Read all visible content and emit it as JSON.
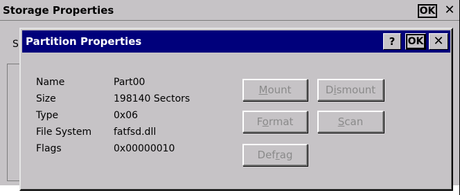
{
  "outer_window": {
    "title": "Storage Properties",
    "ok_label": "OK",
    "close_glyph": "✕",
    "tab_letter": "S"
  },
  "dialog": {
    "title": "Partition Properties",
    "help_label": "?",
    "ok_label": "OK",
    "close_glyph": "✕"
  },
  "properties": [
    {
      "label": "Name",
      "value": "Part00"
    },
    {
      "label": "Size",
      "value": "198140 Sectors"
    },
    {
      "label": "Type",
      "value": "0x06"
    },
    {
      "label": "File System",
      "value": "fatfsd.dll"
    },
    {
      "label": "Flags",
      "value": "0x00000010"
    }
  ],
  "buttons": {
    "mount": {
      "pre": "",
      "mnemonic": "M",
      "post": "ount",
      "enabled": false
    },
    "dismount": {
      "pre": "D",
      "mnemonic": "i",
      "post": "smount",
      "enabled": false
    },
    "format": {
      "pre": "F",
      "mnemonic": "o",
      "post": "rmat",
      "enabled": false
    },
    "scan": {
      "pre": "",
      "mnemonic": "S",
      "post": "can",
      "enabled": false
    },
    "defrag": {
      "pre": "Def",
      "mnemonic": "r",
      "post": "ag",
      "enabled": false
    }
  },
  "colors": {
    "window_bg": "#c6c3c6",
    "titlebar_active": "#00007b",
    "disabled_text": "#8a8a8a"
  }
}
